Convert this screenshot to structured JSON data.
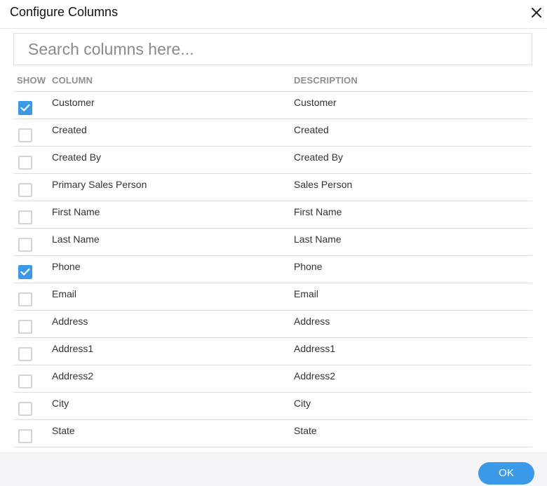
{
  "dialog": {
    "title": "Configure Columns",
    "close_icon": "close-icon",
    "ok_label": "OK",
    "accent_color": "#3b9ae8"
  },
  "search": {
    "placeholder": "Search columns here...",
    "value": ""
  },
  "table": {
    "headers": {
      "show": "SHOW",
      "column": "COLUMN",
      "description": "DESCRIPTION"
    },
    "rows": [
      {
        "column": "Customer",
        "description": "Customer",
        "checked": true
      },
      {
        "column": "Created",
        "description": "Created",
        "checked": false
      },
      {
        "column": "Created By",
        "description": "Created By",
        "checked": false
      },
      {
        "column": "Primary Sales Person",
        "description": "Sales Person",
        "checked": false
      },
      {
        "column": "First Name",
        "description": "First Name",
        "checked": false
      },
      {
        "column": "Last Name",
        "description": "Last Name",
        "checked": false
      },
      {
        "column": "Phone",
        "description": "Phone",
        "checked": true
      },
      {
        "column": "Email",
        "description": "Email",
        "checked": false
      },
      {
        "column": "Address",
        "description": "Address",
        "checked": false
      },
      {
        "column": "Address1",
        "description": "Address1",
        "checked": false
      },
      {
        "column": "Address2",
        "description": "Address2",
        "checked": false
      },
      {
        "column": "City",
        "description": "City",
        "checked": false
      },
      {
        "column": "State",
        "description": "State",
        "checked": false
      }
    ]
  }
}
